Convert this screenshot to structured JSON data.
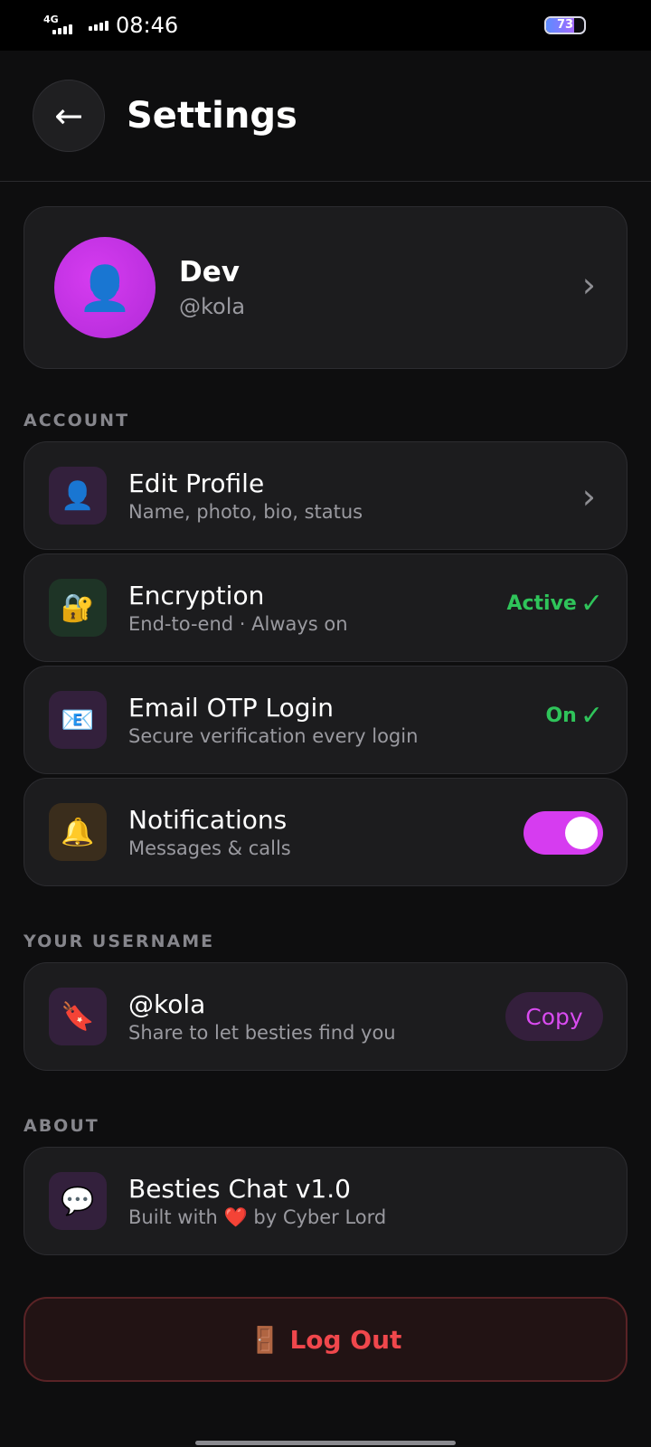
{
  "status_bar": {
    "network": "4G",
    "time": "08:46",
    "battery": "73",
    "battery_level": 0.73
  },
  "header": {
    "back_icon": "arrow-left-icon",
    "title": "Settings"
  },
  "profile": {
    "name": "Dev",
    "username": "@kola",
    "avatar_icon": "person-icon"
  },
  "sections": {
    "account": "ACCOUNT",
    "username": "YOUR USERNAME",
    "about": "ABOUT"
  },
  "account": {
    "edit_profile": {
      "title": "Edit Profile",
      "subtitle": "Name, photo, bio, status",
      "icon": "person-icon"
    },
    "encryption": {
      "title": "Encryption",
      "subtitle": "End-to-end · Always on",
      "status": "Active",
      "icon": "lock-key-icon"
    },
    "email_otp": {
      "title": "Email OTP Login",
      "subtitle": "Secure verification every login",
      "status": "On",
      "icon": "email-icon"
    },
    "notifications": {
      "title": "Notifications",
      "subtitle": "Messages & calls",
      "enabled": true,
      "icon": "bell-icon"
    }
  },
  "username_card": {
    "title": "@kola",
    "subtitle": "Share to let besties find you",
    "copy_label": "Copy",
    "icon": "bookmark-icon"
  },
  "about": {
    "title": "Besties Chat v1.0",
    "subtitle_pre": "Built with",
    "heart": "❤️",
    "subtitle_post": "by Cyber Lord",
    "icon": "chat-bubble-icon"
  },
  "logout": {
    "label": "Log Out",
    "icon": "door-icon"
  },
  "colors": {
    "accent": "#d63cf0",
    "success": "#2fc45a",
    "danger": "#f0474c",
    "background": "#0e0e0f",
    "card": "#1c1c1e"
  }
}
